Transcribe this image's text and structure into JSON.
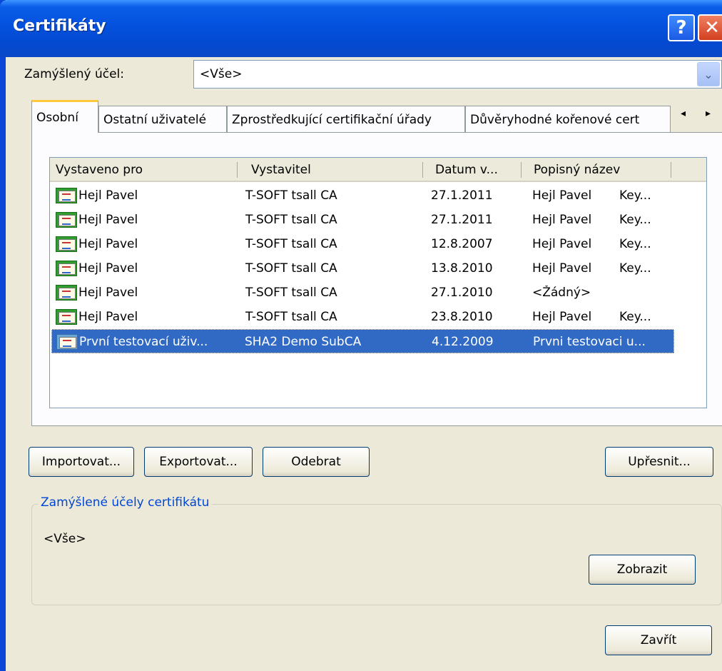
{
  "window": {
    "title": "Certifikáty",
    "help_glyph": "?",
    "close_glyph": "✕"
  },
  "purpose": {
    "label": "Zamýšlený účel:",
    "value": "<Vše>",
    "dropdown_glyph": "⌄"
  },
  "tabs": [
    {
      "label": "Osobní"
    },
    {
      "label": "Ostatní uživatelé"
    },
    {
      "label": "Zprostředkující certifikační úřady"
    },
    {
      "label": "Důvěryhodné kořenové cert"
    }
  ],
  "tab_scroll": {
    "left": "◂",
    "right": "▸"
  },
  "list": {
    "columns": [
      "Vystaveno pro",
      "Vystavitel",
      "Datum v...",
      "Popisný název"
    ],
    "rows": [
      {
        "issued_to": "Hejl Pavel",
        "issuer": "T-SOFT tsall CA",
        "date": "27.1.2011",
        "name": "Hejl Pavel",
        "extra": "Key..."
      },
      {
        "issued_to": "Hejl Pavel",
        "issuer": "T-SOFT tsall CA",
        "date": "27.1.2011",
        "name": "Hejl Pavel",
        "extra": "Key..."
      },
      {
        "issued_to": "Hejl Pavel",
        "issuer": "T-SOFT tsall CA",
        "date": "12.8.2007",
        "name": "Hejl Pavel",
        "extra": "Key..."
      },
      {
        "issued_to": "Hejl Pavel",
        "issuer": "T-SOFT tsall CA",
        "date": "13.8.2010",
        "name": "Hejl Pavel",
        "extra": "Key..."
      },
      {
        "issued_to": "Hejl Pavel",
        "issuer": "T-SOFT tsall CA",
        "date": "27.1.2010",
        "name": "<Žádný>",
        "extra": ""
      },
      {
        "issued_to": "Hejl Pavel",
        "issuer": "T-SOFT tsall CA",
        "date": "23.8.2010",
        "name": "Hejl Pavel",
        "extra": "Key..."
      },
      {
        "issued_to": "První testovací uživ...",
        "issuer": "SHA2 Demo SubCA",
        "date": "4.12.2009",
        "name": "Prvni testovaci u...",
        "extra": ""
      }
    ],
    "selected_index": 6
  },
  "buttons": {
    "import": "Importovat...",
    "export": "Exportovat...",
    "remove": "Odebrat",
    "advanced": "Upřesnit...",
    "view": "Zobrazit",
    "close": "Zavřít"
  },
  "group": {
    "title": "Zamýšlené účely certifikátu",
    "value": "<Vše>"
  }
}
